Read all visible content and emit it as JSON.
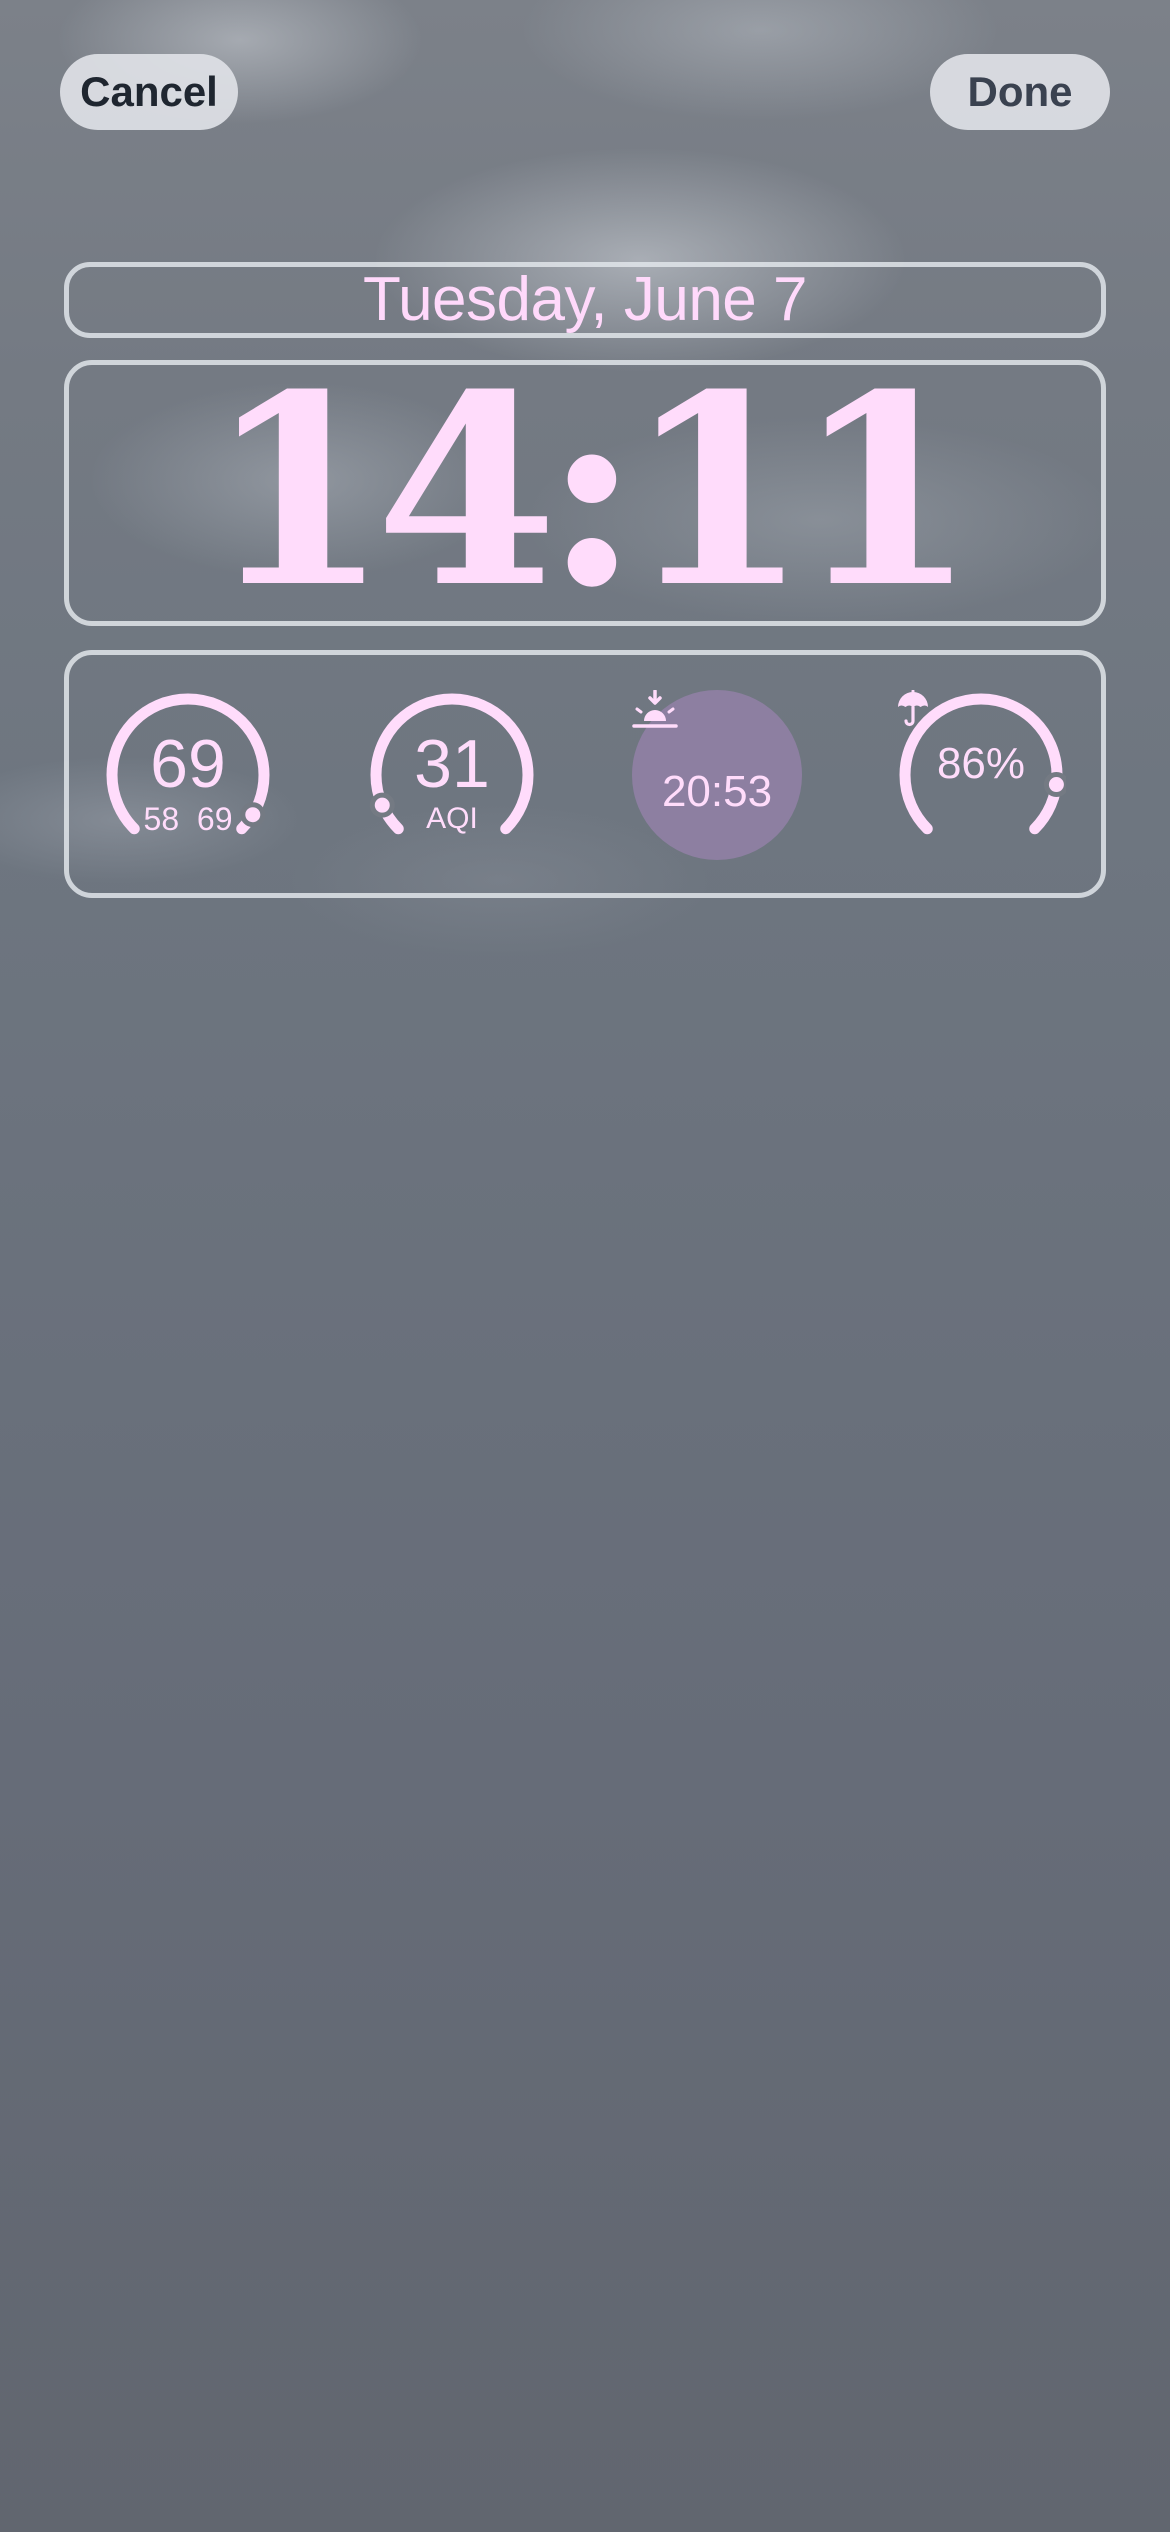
{
  "header": {
    "cancel_label": "Cancel",
    "done_label": "Done"
  },
  "lock_screen": {
    "date": "Tuesday, June 7",
    "time": "14:11"
  },
  "widgets": {
    "temperature": {
      "current": "69",
      "low": "58",
      "high": "69",
      "level": 0.95
    },
    "air_quality": {
      "value": "31",
      "label": "AQI",
      "level": 0.08
    },
    "sunset": {
      "time": "20:53",
      "icon": "sunset-icon"
    },
    "rain_chance": {
      "value": "86%",
      "icon": "umbrella-icon",
      "level": 0.86
    }
  },
  "colors": {
    "accent_pink": "#ffdcfb",
    "sunset_disc": "#9682aa"
  }
}
